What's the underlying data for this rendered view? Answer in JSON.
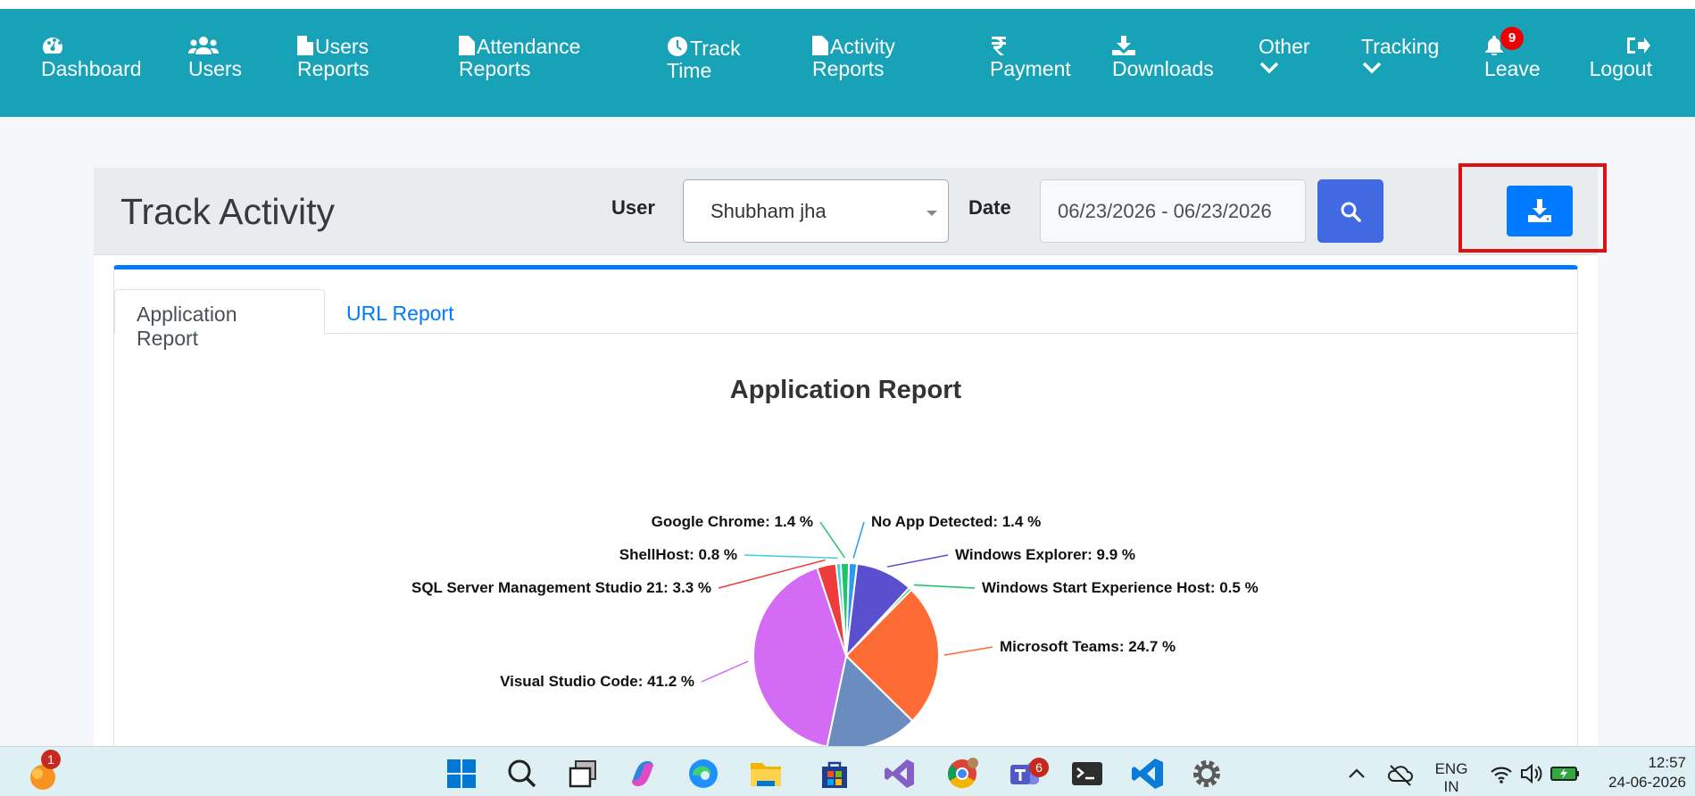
{
  "nav": {
    "dashboard": "Dashboard",
    "users": "Users",
    "users_reports_1": "Users",
    "users_reports_2": "Reports",
    "attendance_1": "Attendance",
    "attendance_2": "Reports",
    "track_1": "Track",
    "track_2": "Time",
    "activity_1": "Activity",
    "activity_2": "Reports",
    "payment": "Payment",
    "downloads": "Downloads",
    "other": "Other",
    "tracking": "Tracking",
    "leave": "Leave",
    "leave_badge": "9",
    "logout": "Logout"
  },
  "header": {
    "title": "Track Activity",
    "user_label": "User",
    "user_value": "Shubham jha",
    "date_label": "Date",
    "date_value": "06/23/2026 - 06/23/2026"
  },
  "tabs": [
    {
      "label": "Application Report",
      "active": true
    },
    {
      "label": "URL Report",
      "active": false
    }
  ],
  "chart_data": {
    "type": "pie",
    "title": "Application Report",
    "slices": [
      {
        "label": "No App Detected",
        "value": 1.4,
        "color": "#2b9af3"
      },
      {
        "label": "Windows Explorer",
        "value": 9.9,
        "color": "#5a4fcf"
      },
      {
        "label": "Windows Start Experience Host",
        "value": 0.5,
        "color": "#12c26b"
      },
      {
        "label": "Microsoft Teams",
        "value": 24.7,
        "color": "#ff6b35"
      },
      {
        "label": "",
        "value": 15.8,
        "color": "#6b8cbe"
      },
      {
        "label": "Visual Studio Code",
        "value": 41.2,
        "color": "#d36bf5"
      },
      {
        "label": "SQL Server Management Studio 21",
        "value": 3.3,
        "color": "#ee3b3b"
      },
      {
        "label": "ShellHost",
        "value": 0.8,
        "color": "#3fd0d8"
      },
      {
        "label": "Google Chrome",
        "value": 1.4,
        "color": "#1ec46a"
      }
    ],
    "label_suffix": " %"
  },
  "taskbar": {
    "widget_badge": "1",
    "teams_badge": "6",
    "lang_1": "ENG",
    "lang_2": "IN",
    "time": "12:57",
    "date": "24-06-2026"
  }
}
